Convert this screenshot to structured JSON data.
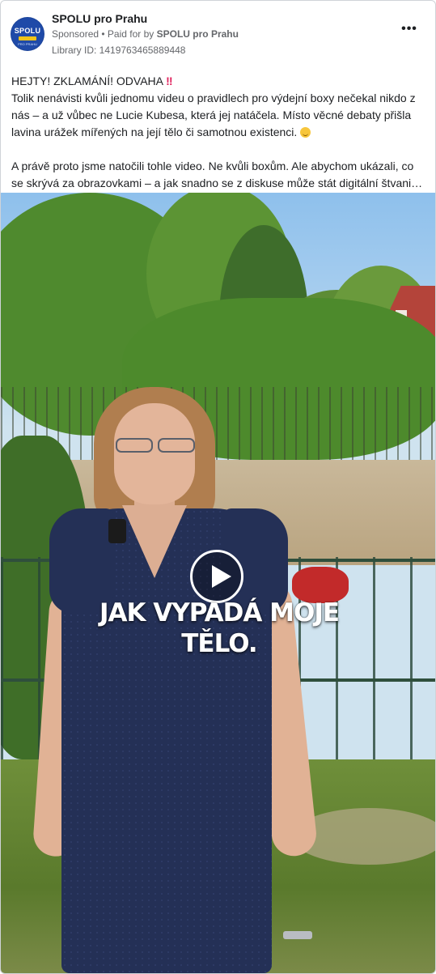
{
  "post": {
    "page_name": "SPOLU pro Prahu",
    "sponsored": "Sponsored",
    "separator": " • ",
    "paid_for_prefix": "Paid for by ",
    "paid_for_by": "SPOLU pro Prahu",
    "library_id": "Library ID: 1419763465889448",
    "more_icon": "more-horizontal-icon",
    "avatar": {
      "logo_text": "SPOLU",
      "sub_text": "PRO PRAHU",
      "bg": "#1f4aa8",
      "bar": "#f0c419"
    }
  },
  "text": {
    "line1": "HEJTY! ZKLAMÁNÍ! ODVAHA",
    "line1_emoji": "‼",
    "para1": "Tolik nenávisti kvůli jednomu videu o pravidlech pro výdejní boxy nečekal nikdo z nás – a už vůbec ne Lucie Kubesa, která jej natáčela. Místo věcné debaty přišla lavina urážek mířených na její tělo či samotnou existenci.",
    "para2_a": "A právě proto jsme natočili tohle video. Ne kvůli boxům. Ale abychom ukázali, co",
    "para2_b": "se skrývá za obrazovkami – a jak snadno se z diskuse může stát digitální štvanic…"
  },
  "video": {
    "caption_line1": "JAK VYPADÁ MOJE",
    "caption_line2": "TĚLO.",
    "play_icon": "play-icon"
  },
  "colors": {
    "text": "#1c1e21",
    "secondary": "#65676b",
    "border": "#cfd3d8"
  }
}
